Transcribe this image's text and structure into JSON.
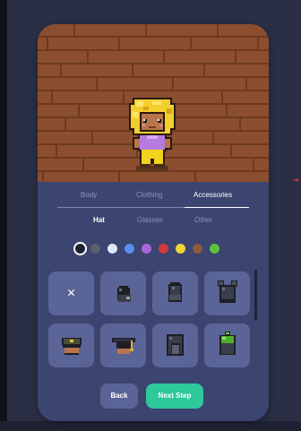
{
  "tabs": [
    {
      "label": "Body",
      "active": false
    },
    {
      "label": "Clothing",
      "active": false
    },
    {
      "label": "Accessories",
      "active": true
    }
  ],
  "subtabs": [
    {
      "label": "Hat",
      "active": true
    },
    {
      "label": "Glasses",
      "active": false
    },
    {
      "label": "Other",
      "active": false
    }
  ],
  "colors": {
    "selected_index": 0,
    "swatches": [
      "#1f2233",
      "#5a5f6a",
      "#dfe6ff",
      "#5b8df0",
      "#a866d8",
      "#d23b3b",
      "#f1d43a",
      "#8d5a3a",
      "#5ec23f"
    ]
  },
  "items": [
    {
      "name": "none",
      "icon": "close-icon",
      "symbol": "✕"
    },
    {
      "name": "black-cap",
      "icon": "cap-icon"
    },
    {
      "name": "dark-beanie",
      "icon": "beanie-icon"
    },
    {
      "name": "bear-ears-hat",
      "icon": "bear-ears-hat-icon"
    },
    {
      "name": "army-cap",
      "icon": "army-cap-icon"
    },
    {
      "name": "graduation-cap",
      "icon": "graduation-cap-icon"
    },
    {
      "name": "hood",
      "icon": "hood-icon"
    },
    {
      "name": "green-beanie",
      "icon": "green-beanie-icon"
    }
  ],
  "buttons": {
    "back_label": "Back",
    "next_label": "Next Step"
  },
  "theme": {
    "card_bg": "#3c4470",
    "tile_bg": "#5b6496",
    "accent": "#2ec99a",
    "floor": "#8b4e2f"
  }
}
